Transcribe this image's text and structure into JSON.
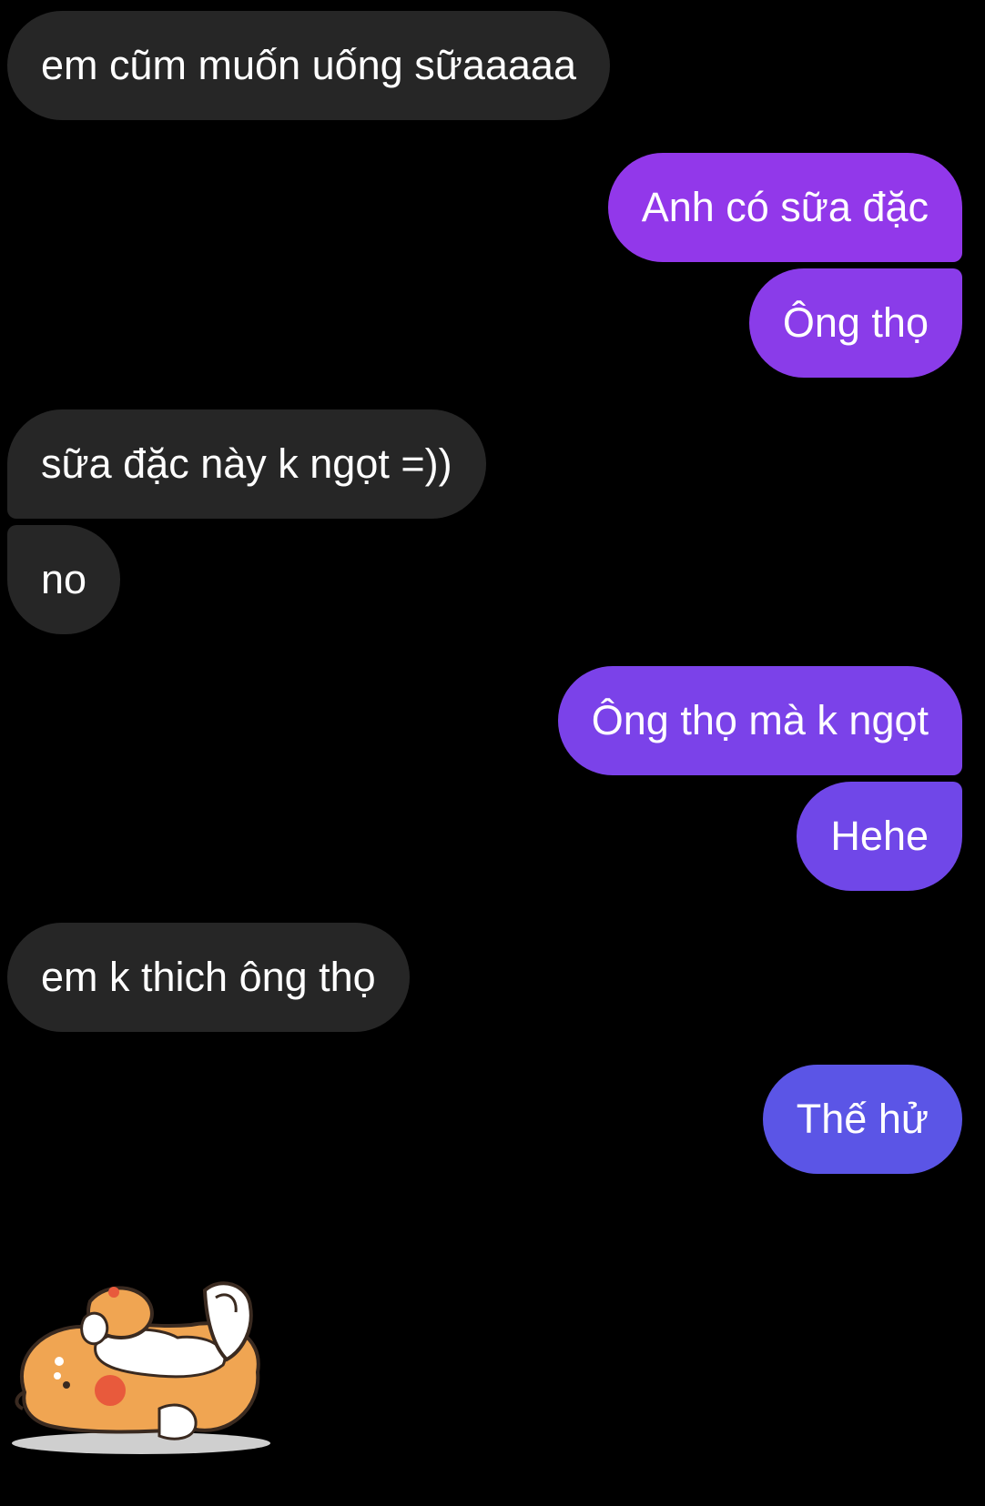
{
  "conversation": {
    "messages": [
      {
        "text": "em cũm muốn uống sữaaaaa",
        "sender": "received"
      },
      {
        "text": "Anh có sữa đặc",
        "sender": "sent"
      },
      {
        "text": "Ông thọ",
        "sender": "sent"
      },
      {
        "text": "sữa đặc này k ngọt =))",
        "sender": "received"
      },
      {
        "text": "no",
        "sender": "received"
      },
      {
        "text": "Ông thọ mà k ngọt",
        "sender": "sent"
      },
      {
        "text": "Hehe",
        "sender": "sent"
      },
      {
        "text": "em k thich ông thọ",
        "sender": "received"
      },
      {
        "text": "Thế hử",
        "sender": "sent"
      }
    ],
    "sticker": {
      "icon": "shiba-dog-rolling-sticker",
      "sender": "received"
    }
  },
  "colors": {
    "background": "#000000",
    "received_bubble": "#262626",
    "sent_gradient_top": "#9238ea",
    "sent_gradient_bottom": "#5b55e6",
    "text": "#ffffff"
  }
}
